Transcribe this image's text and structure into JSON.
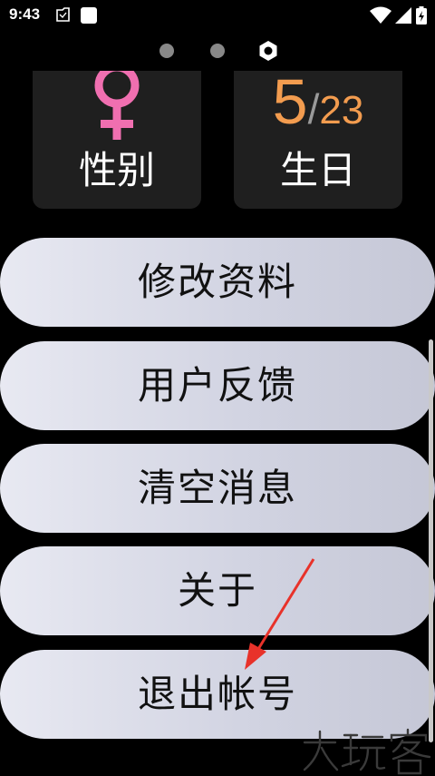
{
  "status_bar": {
    "time": "9:43",
    "icons": [
      "notification-icon",
      "app-square-icon",
      "wifi-icon",
      "signal-icon",
      "battery-charging-icon"
    ]
  },
  "page_indicator": {
    "total": 3,
    "active_index": 2
  },
  "cards": {
    "gender": {
      "icon": "female-symbol-icon",
      "icon_color": "#f06fb0",
      "label": "性别"
    },
    "birthday": {
      "month": "5",
      "separator": "/",
      "day": "23",
      "value_color": "#f39c4f",
      "label": "生日"
    }
  },
  "menu": {
    "edit_profile": "修改资料",
    "feedback": "用户反馈",
    "clear_messages": "清空消息",
    "about": "关于",
    "logout": "退出帐号"
  },
  "colors": {
    "background": "#000000",
    "card_background": "#1f1f1f",
    "button_gradient_start": "#e8e9f2",
    "button_gradient_end": "#c5c7d6",
    "annotation_arrow": "#e8322a"
  }
}
